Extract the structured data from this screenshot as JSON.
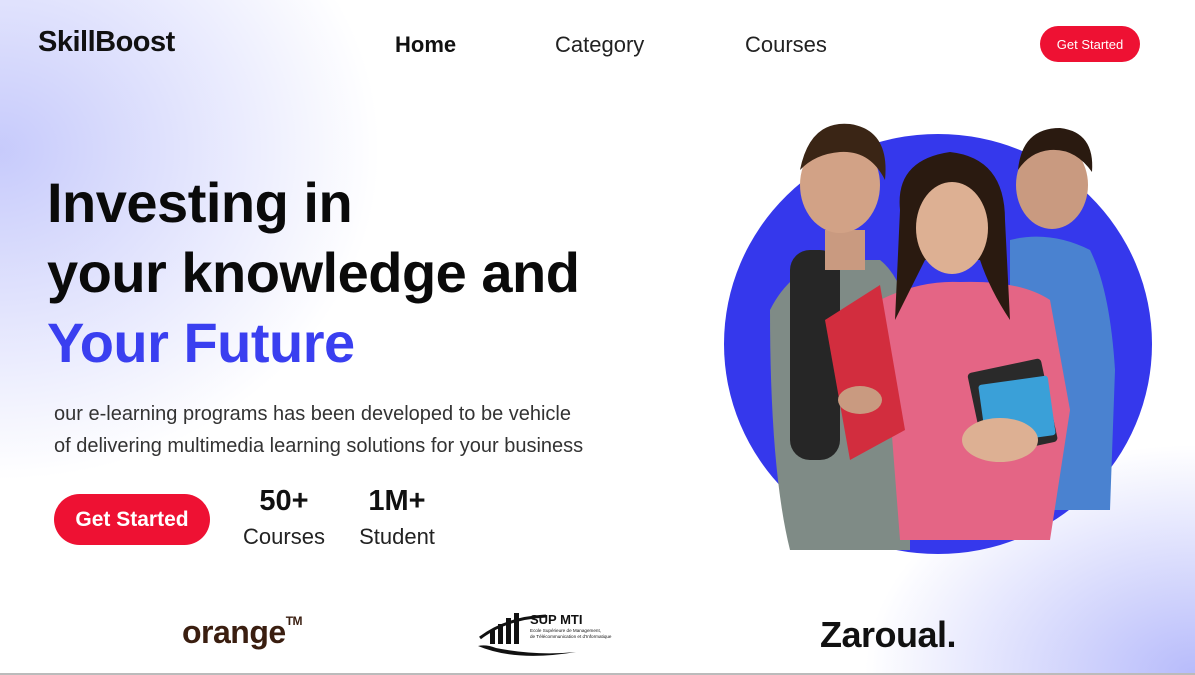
{
  "header": {
    "logo": "SkillBoost",
    "nav": [
      {
        "label": "Home"
      },
      {
        "label": "Category"
      },
      {
        "label": "Courses"
      }
    ],
    "cta_label": "Get Started"
  },
  "hero": {
    "headline_line1": "Investing in",
    "headline_line2": "your knowledge and",
    "headline_accent": "Your Future",
    "subtext_line1": "our e-learning programs has been developed to be vehicle",
    "subtext_line2": "of delivering multimedia learning solutions for your business",
    "cta_label": "Get Started",
    "stats": [
      {
        "value": "50+",
        "label": "Courses"
      },
      {
        "value": "1M+",
        "label": "Student"
      }
    ]
  },
  "partners": {
    "orange": "orange",
    "orange_tm": "TM",
    "supmti_title": "SUP MTI",
    "supmti_sub1": "Ecole Supérieure de Management,",
    "supmti_sub2": "de Télécommunication et d'Informatique",
    "zaroual": "Zaroual."
  },
  "colors": {
    "accent_blue": "#3a3ff0",
    "cta_red": "#ee1133",
    "circle_blue": "#3538ec"
  }
}
